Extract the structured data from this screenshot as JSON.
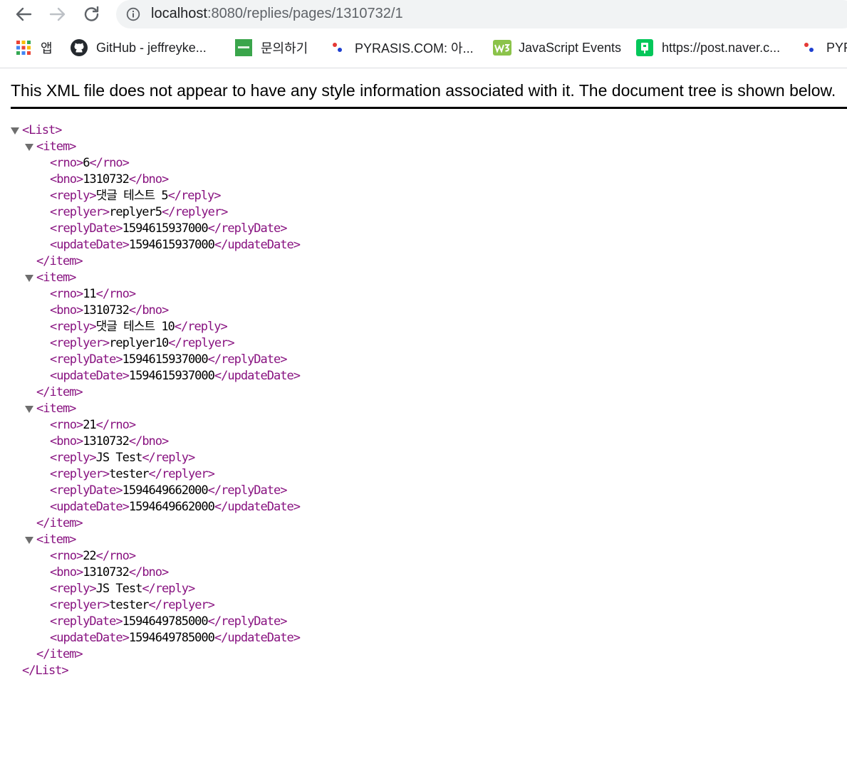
{
  "address_bar": {
    "host": "localhost",
    "path": ":8080/replies/pages/1310732/1"
  },
  "bookmarks": [
    {
      "label": "앱",
      "icon": "apps-grid-icon"
    },
    {
      "label": "GitHub - jeffreyke...",
      "icon": "github-icon"
    },
    {
      "label": "문의하기",
      "icon": "green-site-icon"
    },
    {
      "label": "PYRASIS.COM: 아...",
      "icon": "pyrasis-dots-icon"
    },
    {
      "label": "JavaScript Events",
      "icon": "w3-icon"
    },
    {
      "label": "https://post.naver.c...",
      "icon": "naver-post-icon"
    },
    {
      "label": "PYR",
      "icon": "pyrasis-dots-icon"
    }
  ],
  "notice": "This XML file does not appear to have any style information associated with it. The document tree is shown below.",
  "xml": {
    "root_tag": "List",
    "item_tag": "item",
    "items": [
      {
        "rno": "6",
        "bno": "1310732",
        "reply": "댓글 테스트 5",
        "replyer": "replyer5",
        "replyDate": "1594615937000",
        "updateDate": "1594615937000"
      },
      {
        "rno": "11",
        "bno": "1310732",
        "reply": "댓글 테스트 10",
        "replyer": "replyer10",
        "replyDate": "1594615937000",
        "updateDate": "1594615937000"
      },
      {
        "rno": "21",
        "bno": "1310732",
        "reply": "JS Test",
        "replyer": "tester",
        "replyDate": "1594649662000",
        "updateDate": "1594649662000"
      },
      {
        "rno": "22",
        "bno": "1310732",
        "reply": "JS Test",
        "replyer": "tester",
        "replyDate": "1594649785000",
        "updateDate": "1594649785000"
      }
    ]
  }
}
